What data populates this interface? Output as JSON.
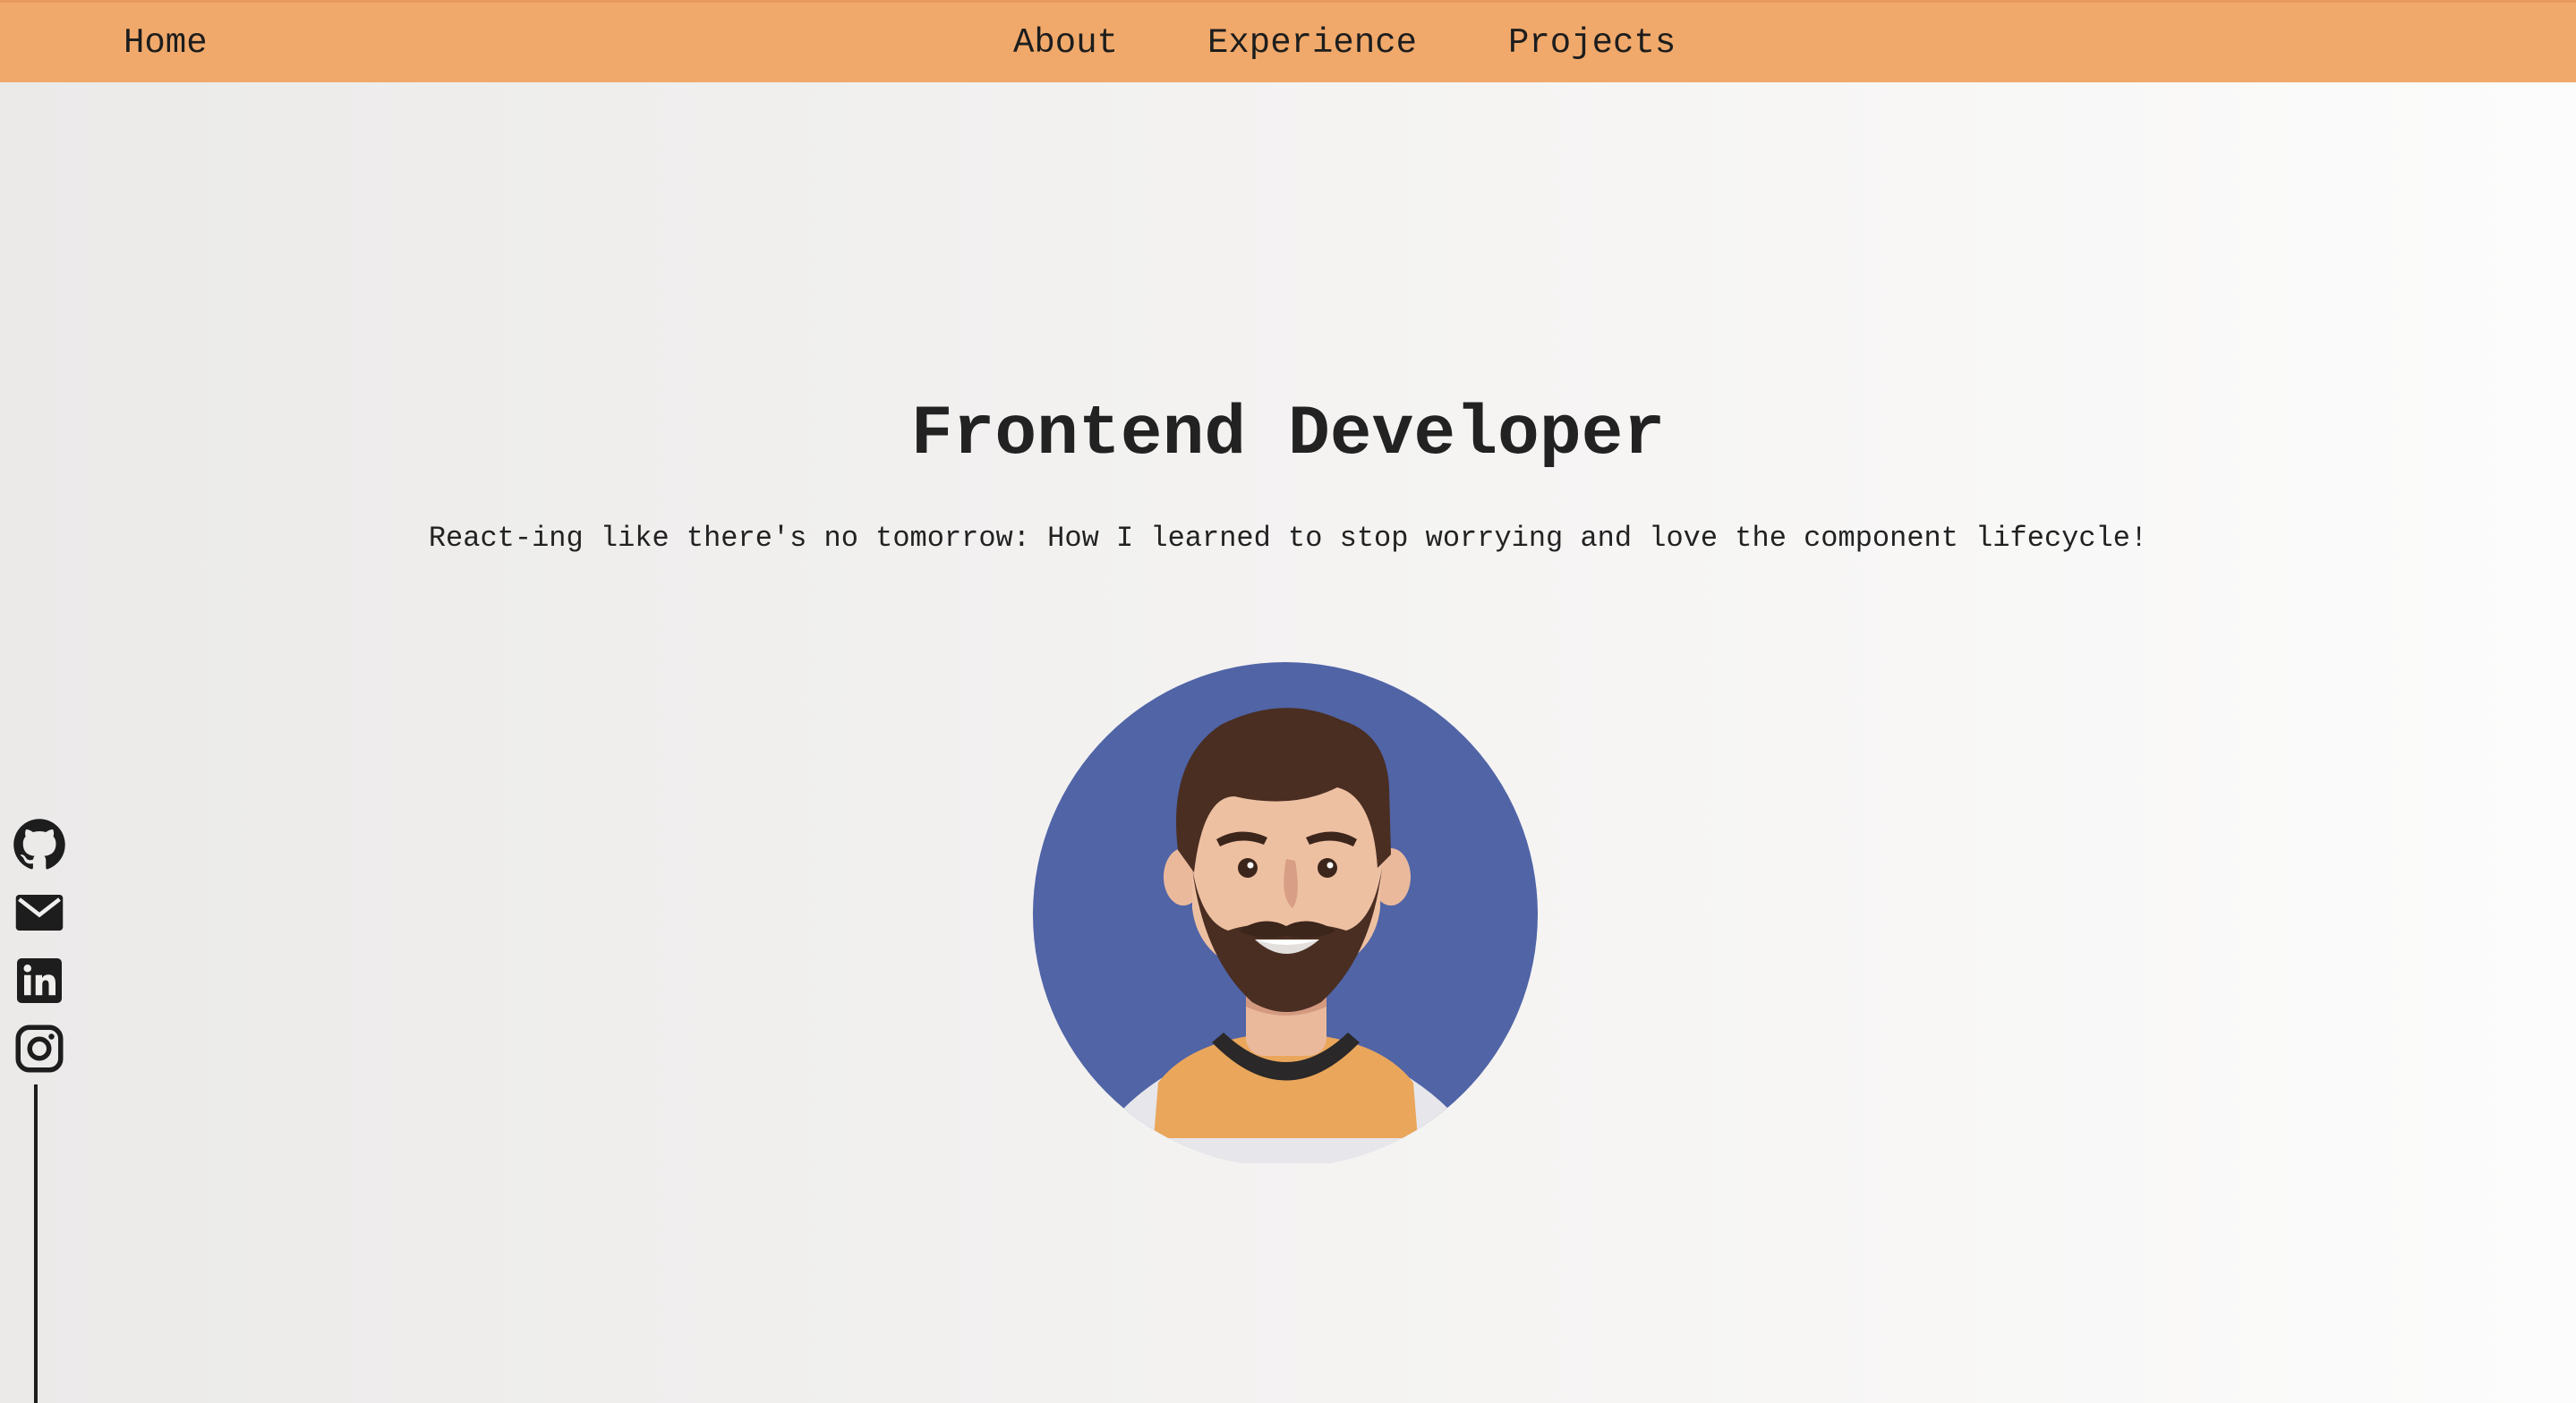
{
  "nav": {
    "home": "Home",
    "about": "About",
    "experience": "Experience",
    "projects": "Projects"
  },
  "hero": {
    "title": "Frontend Developer",
    "subtitle": "React-ing like there's no tomorrow: How I learned to stop worrying and love the component lifecycle!"
  },
  "social": {
    "icons": [
      "github-icon",
      "mail-icon",
      "linkedin-icon",
      "instagram-icon"
    ]
  },
  "colors": {
    "navbar": "#f0a96b",
    "avatar_background": "#5064a6",
    "shirt": "#eaa65b",
    "text": "#222222"
  }
}
